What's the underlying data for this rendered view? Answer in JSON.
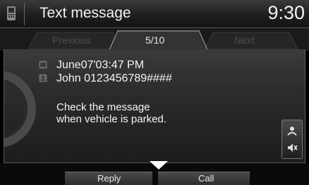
{
  "header": {
    "title": "Text message",
    "time": "9:30",
    "icon": "phone-icon"
  },
  "tabs": {
    "previous": "Previous",
    "counter": "5/10",
    "next": "Next"
  },
  "message": {
    "datetime": "June07'03:47 PM",
    "sender": "John 0123456789####",
    "body_line1": "Check the message",
    "body_line2": "when vehicle is parked.",
    "date_icon": "calendar-icon",
    "sender_icon": "contact-icon"
  },
  "side_button": {
    "icon": "voice-mute-icon"
  },
  "bottom": {
    "reply": "Reply",
    "call": "Call",
    "scroll_icon": "chevron-down-icon"
  },
  "colors": {
    "background": "#000000",
    "text": "#f4f4f4",
    "inactive_tab_text": "#4d4d4d"
  }
}
